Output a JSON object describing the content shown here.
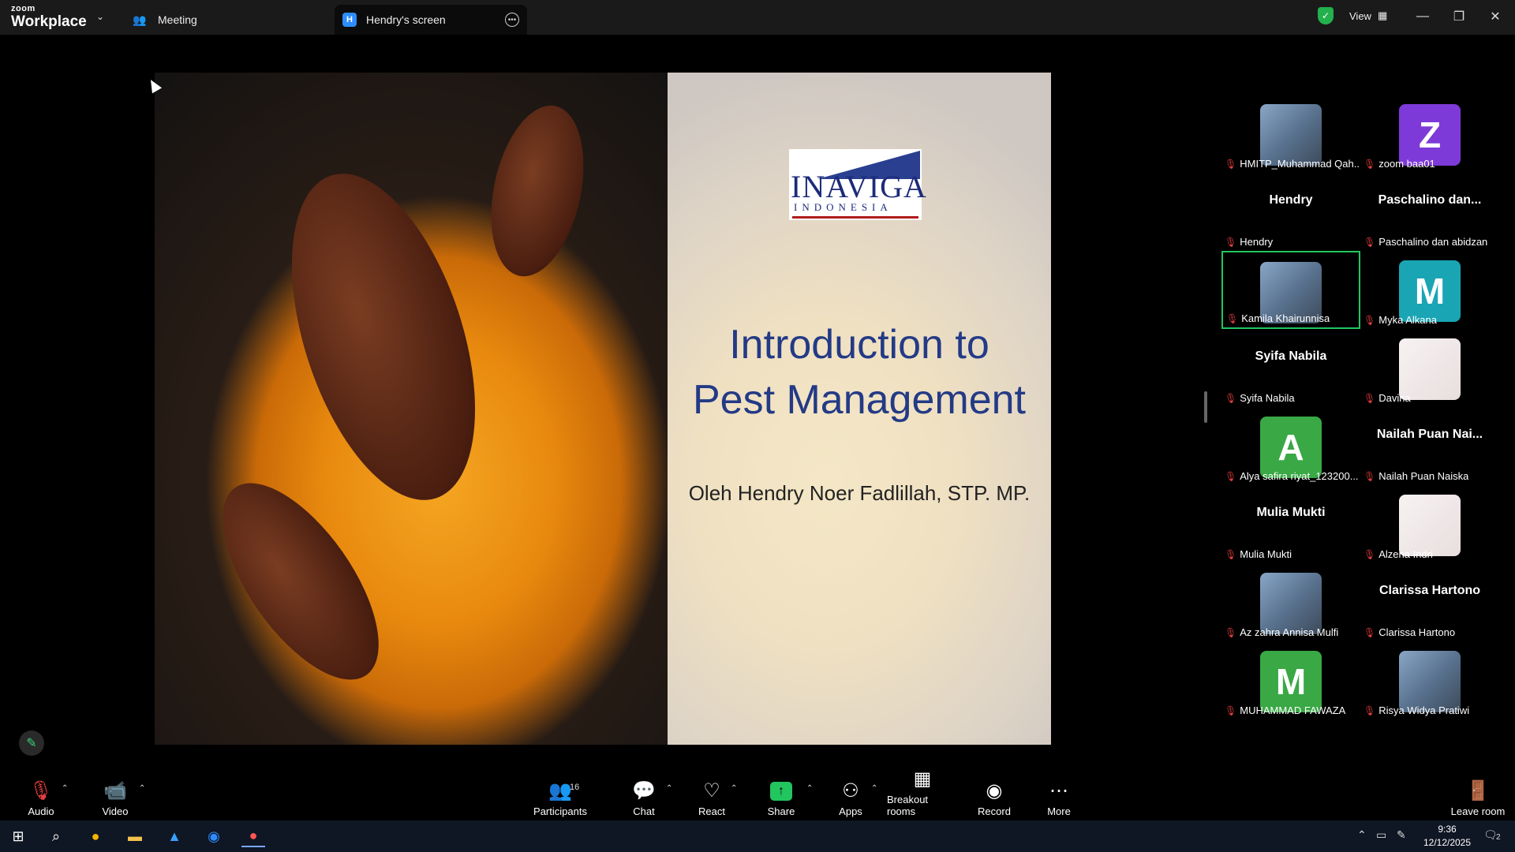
{
  "titlebar": {
    "logo_small": "zoom",
    "logo_big": "Workplace",
    "tab_meeting": "Meeting",
    "tab_screen_badge": "H",
    "tab_screen": "Hendry's screen",
    "view_label": "View"
  },
  "slide": {
    "logo_main": "INAVIGA",
    "logo_sub": "INDONESIA",
    "title_line1": "Introduction to",
    "title_line2": "Pest Management",
    "author": "Oleh Hendry Noer Fadlillah, STP. MP."
  },
  "gallery": [
    {
      "name": "HMITP_Muhammad Qah...",
      "avatar": "photo",
      "display": ""
    },
    {
      "name": "zoom baa01",
      "avatar": "letter",
      "letter": "Z",
      "color": "#7e3ad8"
    },
    {
      "name": "Hendry",
      "avatar": "name",
      "display": "Hendry"
    },
    {
      "name": "Paschalino dan abidzan",
      "avatar": "name",
      "display": "Paschalino dan..."
    },
    {
      "name": "Kamila Khairunnisa",
      "avatar": "photo",
      "active": true
    },
    {
      "name": "Myka Alkana",
      "avatar": "letter",
      "letter": "M",
      "color": "#1aa5b4"
    },
    {
      "name": "Syifa Nabila",
      "avatar": "name",
      "display": "Syifa Nabila"
    },
    {
      "name": "Davina",
      "avatar": "photo-light"
    },
    {
      "name": "Alya safira riyat_123200...",
      "avatar": "letter",
      "letter": "A",
      "color": "#39a845"
    },
    {
      "name": "Nailah Puan Naiska",
      "avatar": "name",
      "display": "Nailah Puan Nai..."
    },
    {
      "name": "Mulia Mukti",
      "avatar": "name",
      "display": "Mulia Mukti"
    },
    {
      "name": "Alzena Indri",
      "avatar": "photo-light"
    },
    {
      "name": "Az zahra Annisa Mulfi",
      "avatar": "photo"
    },
    {
      "name": "Clarissa Hartono",
      "avatar": "name",
      "display": "Clarissa Hartono"
    },
    {
      "name": "MUHAMMAD FAWAZA",
      "avatar": "letter",
      "letter": "M",
      "color": "#39a845"
    },
    {
      "name": "Risya Widya Pratiwi",
      "avatar": "photo"
    }
  ],
  "toolbar": {
    "audio": "Audio",
    "video": "Video",
    "participants": "Participants",
    "participants_count": "16",
    "chat": "Chat",
    "react": "React",
    "share": "Share",
    "apps": "Apps",
    "breakout": "Breakout rooms",
    "record": "Record",
    "more": "More",
    "leave": "Leave room"
  },
  "taskbar": {
    "time": "9:36",
    "date": "12/12/2025",
    "notifications": "2"
  }
}
